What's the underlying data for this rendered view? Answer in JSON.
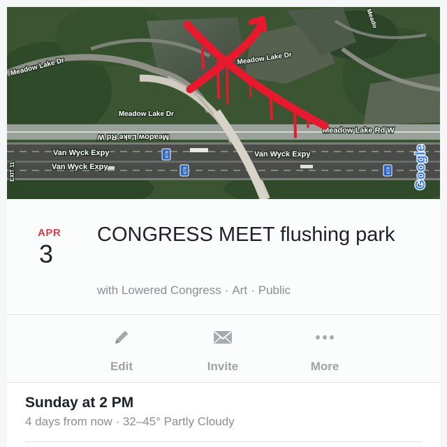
{
  "map": {
    "road_labels": {
      "meadow_lake_dr_left": "Meadow Lake Dr",
      "meadow_lake_dr_top": "Meadow Lake Dr",
      "meadow_lake_dr_center": "Meadow Lake Dr",
      "meadow_lake_rd_w_mirrored": "Meadow Lake Rd W",
      "meadow_lake_rd_w_right": "Meadow Lake Rd W",
      "van_wyck_1": "Van Wyck Expy",
      "van_wyck_2": "Van Wyck Expy",
      "van_wyck_3": "Van Wyck Expy",
      "meadow_corner": "Meado",
      "shield_1": "678",
      "shield_2": "678",
      "shield_3": "678",
      "left_edge": "EXIT 11"
    },
    "watermark": "Google",
    "annotation_color": "#e8192c"
  },
  "event": {
    "month": "APR",
    "day": "3",
    "title": "CONGRESS MEET flushing park",
    "host": "with Lowered Congress",
    "category": "Art",
    "privacy": "Public",
    "separator": "·"
  },
  "actions": [
    {
      "label": "Edit",
      "icon": "pencil-icon"
    },
    {
      "label": "Invite",
      "icon": "envelope-icon"
    },
    {
      "label": "More",
      "icon": "more-dots-icon"
    }
  ],
  "schedule": {
    "when": "Sunday at 2 PM",
    "detail": "4 days from now · 32–45° Partly Cloudy"
  },
  "colors": {
    "accent_date": "#d64045",
    "muted_text": "#8a8d91",
    "icon_gray": "#a6a9ad"
  }
}
